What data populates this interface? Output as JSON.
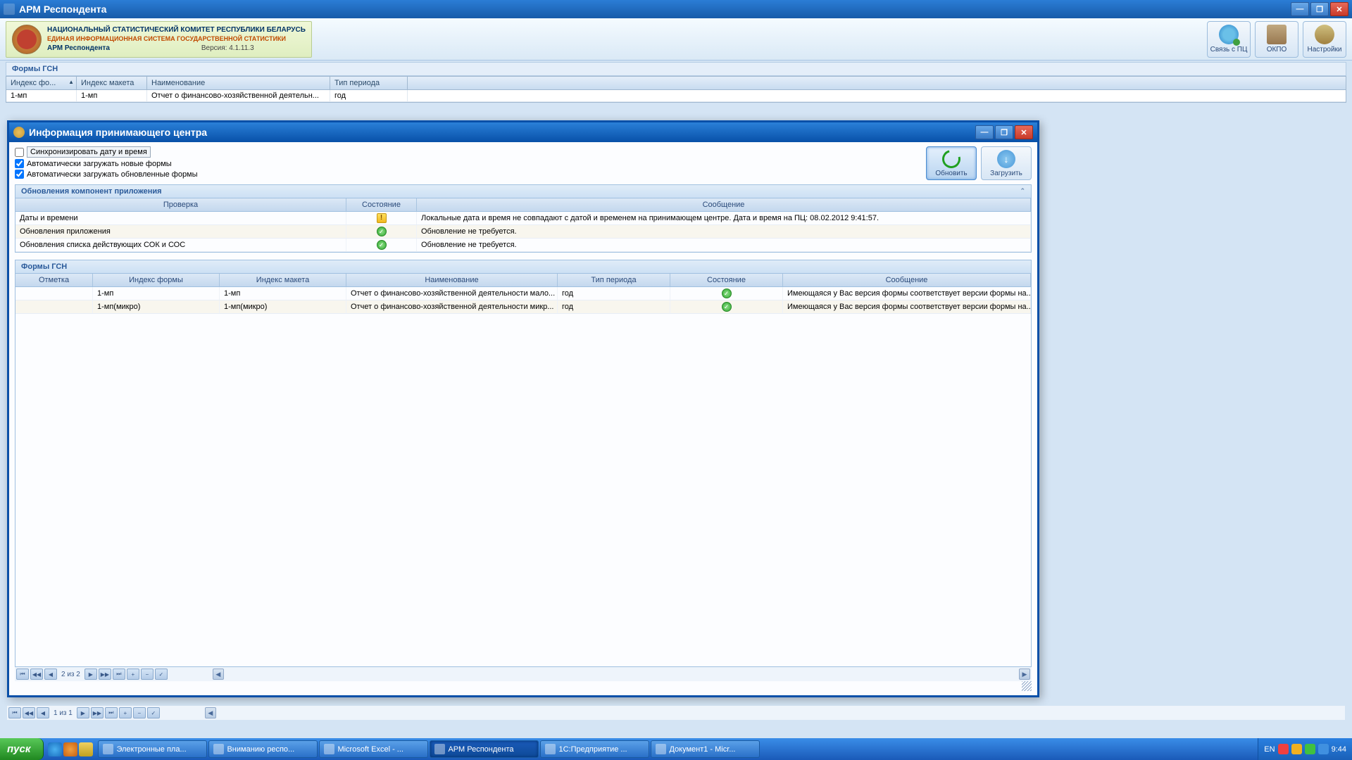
{
  "mainWindow": {
    "title": "АРМ Респондента"
  },
  "banner": {
    "line1": "НАЦИОНАЛЬНЫЙ СТАТИСТИЧЕСКИЙ КОМИТЕТ РЕСПУБЛИКИ БЕЛАРУСЬ",
    "line2": "ЕДИНАЯ ИНФОРМАЦИОННАЯ СИСТЕМА ГОСУДАРСТВЕННОЙ СТАТИСТИКИ",
    "line3": "АРМ Респондента",
    "version": "Версия: 4.1.11.3",
    "tools": {
      "link": "Связь с ПЦ",
      "okpo": "ОКПО",
      "settings": "Настройки"
    }
  },
  "formsSection": {
    "title": "Формы ГСН",
    "cols": [
      "Индекс фо...",
      "Индекс макета",
      "Наименование",
      "Тип периода"
    ],
    "row": [
      "1-мп",
      "1-мп",
      "Отчет о финансово-хозяйственной деятельн...",
      "год"
    ]
  },
  "modal": {
    "title": "Информация принимающего центра",
    "chk_sync": "Синхронизировать дату и время",
    "chk_new": "Автоматически загружать новые формы",
    "chk_upd": "Автоматически загружать обновленные формы",
    "btn_refresh": "Обновить",
    "btn_download": "Загрузить",
    "panel1_title": "Обновления компонент приложения",
    "panel1_cols": [
      "Проверка",
      "Состояние",
      "Сообщение"
    ],
    "panel1_rows": [
      {
        "check": "Даты и времени",
        "status": "warn",
        "msg": "Локальные дата и время не совпадают с датой и временем на принимающем центре. Дата и время на ПЦ: 08.02.2012 9:41:57."
      },
      {
        "check": "Обновления приложения",
        "status": "ok",
        "msg": "Обновление не требуется."
      },
      {
        "check": "Обновления списка действующих СОК и СОС",
        "status": "ok",
        "msg": "Обновление не требуется."
      }
    ],
    "panel2_title": "Формы ГСН",
    "panel2_cols": [
      "Отметка",
      "Индекс формы",
      "Индекс макета",
      "Наименование",
      "Тип периода",
      "Состояние",
      "Сообщение"
    ],
    "panel2_rows": [
      {
        "idx": "1-мп",
        "maket": "1-мп",
        "name": "Отчет о финансово-хозяйственной деятельности мало...",
        "period": "год",
        "status": "ok",
        "msg": "Имеющаяся у Вас версия формы соответствует версии формы на..."
      },
      {
        "idx": "1-мп(микро)",
        "maket": "1-мп(микро)",
        "name": "Отчет о финансово-хозяйственной деятельности микр...",
        "period": "год",
        "status": "ok",
        "msg": "Имеющаяся у Вас версия формы соответствует версии формы на..."
      }
    ],
    "nav_info": "2 из 2"
  },
  "outerNav": "1 из 1",
  "taskbar": {
    "start": "пуск",
    "items": [
      {
        "label": "Электронные пла...",
        "active": false
      },
      {
        "label": "Вниманию респо...",
        "active": false
      },
      {
        "label": "Microsoft Excel - ...",
        "active": false
      },
      {
        "label": "АРМ Респондента",
        "active": true
      },
      {
        "label": "1С:Предприятие ...",
        "active": false
      },
      {
        "label": "Документ1 - Micr...",
        "active": false
      }
    ],
    "lang": "EN",
    "time": "9:44"
  }
}
